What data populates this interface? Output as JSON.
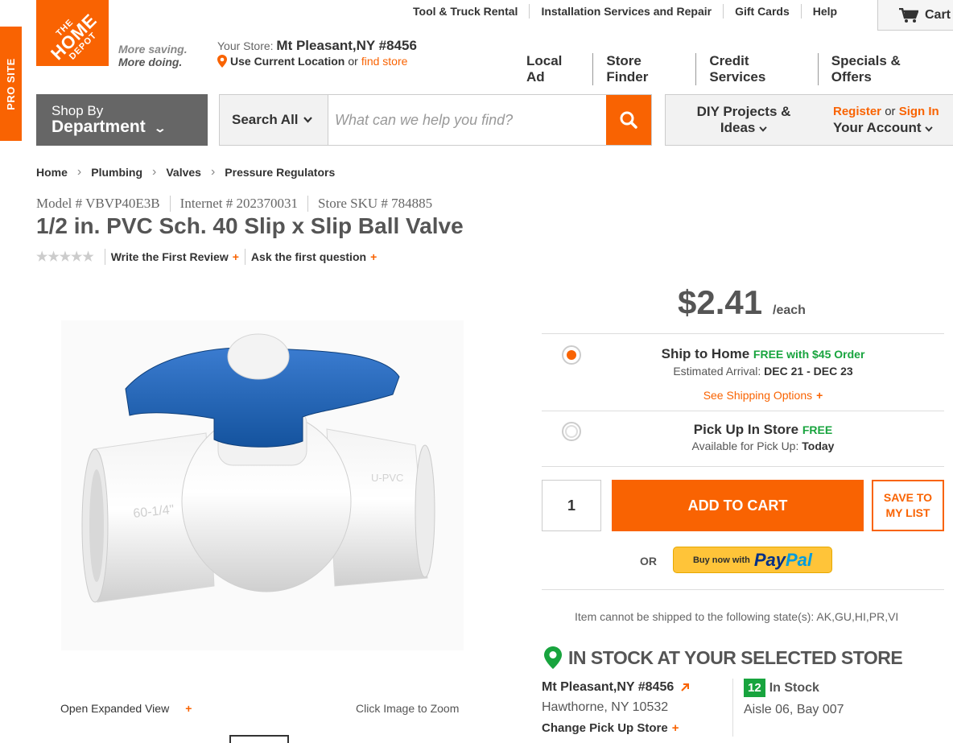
{
  "pro_tab": {
    "label": "PRO SITE"
  },
  "logo": {
    "line1": "THE",
    "line2": "HOME",
    "line3": "DEPOT",
    "tagline1": "More saving.",
    "tagline2": "More doing."
  },
  "util_nav": [
    "Tool & Truck Rental",
    "Installation Services and Repair",
    "Gift Cards",
    "Help"
  ],
  "cart": {
    "label": "Cart"
  },
  "store": {
    "prefix": "Your Store:",
    "name": "Mt Pleasant,NY #8456",
    "use_location": "Use Current Location",
    "or": "or",
    "find_store": "find store"
  },
  "main_nav": [
    "Local Ad",
    "Store Finder",
    "Credit Services",
    "Specials & Offers"
  ],
  "dept": {
    "line1": "Shop By",
    "line2": "Department"
  },
  "search": {
    "scope": "Search All",
    "placeholder": "What can we help you find?"
  },
  "diy": {
    "line1": "DIY Projects &",
    "line2": "Ideas"
  },
  "account": {
    "register": "Register",
    "or": "or",
    "sign_in": "Sign In",
    "line2": "Your Account"
  },
  "breadcrumb": [
    "Home",
    "Plumbing",
    "Valves",
    "Pressure Regulators"
  ],
  "product": {
    "model": "Model # VBVP40E3B",
    "internet": "Internet # 202370031",
    "sku": "Store SKU # 784885",
    "title": "1/2 in. PVC Sch. 40 Slip x Slip Ball Valve",
    "rating": 0,
    "stars": "★★★★★",
    "write_review": "Write the First Review",
    "ask_question": "Ask the first question",
    "price": "$2.41",
    "unit": "/each"
  },
  "image": {
    "expand": "Open Expanded View",
    "zoom": "Click Image to Zoom"
  },
  "fulfillment": {
    "ship": {
      "title": "Ship to Home",
      "free": "FREE with $45 Order",
      "arrival_label": "Estimated Arrival:",
      "arrival": "DEC 21 - DEC 23",
      "options": "See Shipping Options"
    },
    "pickup": {
      "title": "Pick Up In Store",
      "free": "FREE",
      "avail_label": "Available for Pick Up:",
      "avail": "Today"
    }
  },
  "cart_actions": {
    "qty": "1",
    "add_to_cart": "ADD TO CART",
    "save_line1": "SAVE TO",
    "save_line2": "MY LIST",
    "or": "OR",
    "paypal_buy": "Buy now with",
    "paypal_pay": "Pay",
    "paypal_pal": "Pal"
  },
  "ship_note": "Item cannot be shipped to the following state(s): AK,GU,HI,PR,VI",
  "stock": {
    "heading": "IN STOCK AT YOUR SELECTED STORE",
    "store_name": "Mt Pleasant,NY #8456",
    "address": "Hawthorne, NY 10532",
    "change": "Change Pick Up Store",
    "count": "12",
    "count_label": "In Stock",
    "aisle": "Aisle 06, Bay 007"
  },
  "colors": {
    "brand": "#f96302",
    "green": "#18a43e",
    "blue_handle": "#1f5fa8"
  }
}
